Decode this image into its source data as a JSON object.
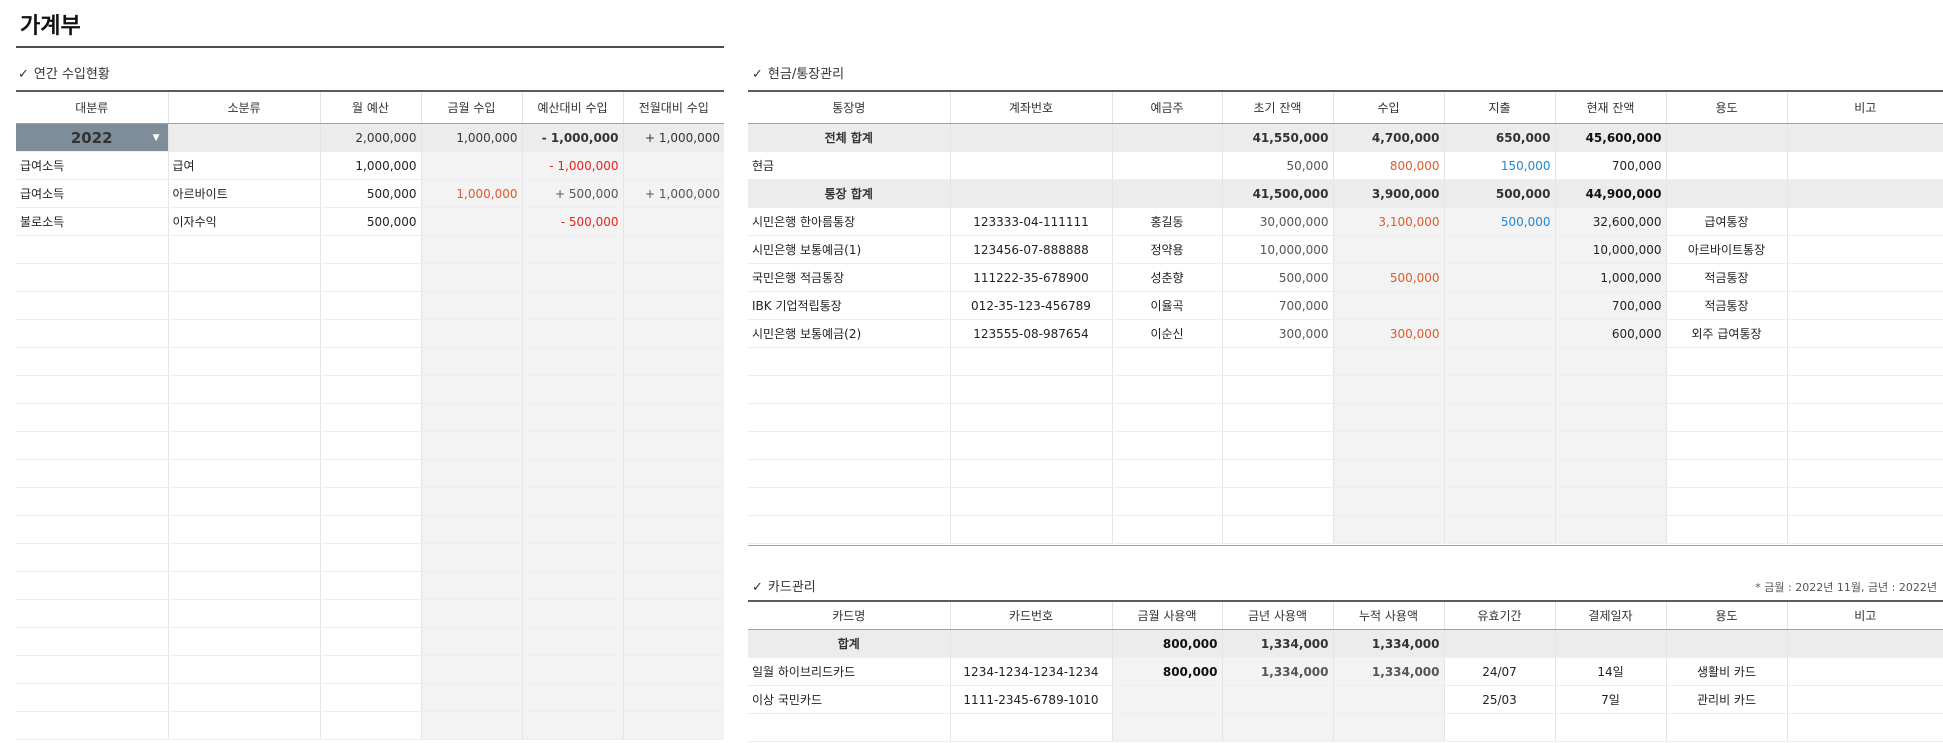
{
  "page": {
    "title": "가계부"
  },
  "income": {
    "section_title": "연간 수입현황",
    "headers": [
      "대분류",
      "소분류",
      "월 예산",
      "금월 수입",
      "예산대비 수입",
      "전월대비 수입"
    ],
    "year": "2022",
    "summary": {
      "budget": "2,000,000",
      "current": "1,000,000",
      "vs_budget": "- 1,000,000",
      "vs_prev": "+ 1,000,000"
    },
    "rows": [
      {
        "major": "급여소득",
        "minor": "급여",
        "budget": "1,000,000",
        "current": "",
        "vs_budget": "- 1,000,000",
        "vs_prev": ""
      },
      {
        "major": "급여소득",
        "minor": "아르바이트",
        "budget": "500,000",
        "current": "1,000,000",
        "vs_budget": "+ 500,000",
        "vs_prev": "+ 1,000,000"
      },
      {
        "major": "불로소득",
        "minor": "이자수익",
        "budget": "500,000",
        "current": "",
        "vs_budget": "- 500,000",
        "vs_prev": ""
      }
    ]
  },
  "accounts": {
    "section_title": "현금/통장관리",
    "headers": [
      "통장명",
      "계좌번호",
      "예금주",
      "초기 잔액",
      "수입",
      "지출",
      "현재 잔액",
      "용도",
      "비고"
    ],
    "total": {
      "label": "전체 합계",
      "initial": "41,550,000",
      "income": "4,700,000",
      "expense": "650,000",
      "current": "45,600,000"
    },
    "cash": {
      "label": "현금",
      "initial": "50,000",
      "income": "800,000",
      "expense": "150,000",
      "current": "700,000"
    },
    "bank_total": {
      "label": "통장 합계",
      "initial": "41,500,000",
      "income": "3,900,000",
      "expense": "500,000",
      "current": "44,900,000"
    },
    "rows": [
      {
        "name": "시민은행 한아름통장",
        "number": "123333-04-111111",
        "holder": "홍길동",
        "initial": "30,000,000",
        "income": "3,100,000",
        "expense": "500,000",
        "current": "32,600,000",
        "purpose": "급여통장",
        "memo": ""
      },
      {
        "name": "시민은행 보통예금(1)",
        "number": "123456-07-888888",
        "holder": "정약용",
        "initial": "10,000,000",
        "income": "",
        "expense": "",
        "current": "10,000,000",
        "purpose": "아르바이트통장",
        "memo": ""
      },
      {
        "name": "국민은행 적금통장",
        "number": "111222-35-678900",
        "holder": "성춘향",
        "initial": "500,000",
        "income": "500,000",
        "expense": "",
        "current": "1,000,000",
        "purpose": "적금통장",
        "memo": ""
      },
      {
        "name": "IBK 기업적립통장",
        "number": "012-35-123-456789",
        "holder": "이율곡",
        "initial": "700,000",
        "income": "",
        "expense": "",
        "current": "700,000",
        "purpose": "적금통장",
        "memo": ""
      },
      {
        "name": "시민은행 보통예금(2)",
        "number": "123555-08-987654",
        "holder": "이순신",
        "initial": "300,000",
        "income": "300,000",
        "expense": "",
        "current": "600,000",
        "purpose": "외주 급여통장",
        "memo": ""
      }
    ]
  },
  "cards": {
    "section_title": "카드관리",
    "note": "* 금월 : 2022년 11월, 금년 : 2022년",
    "headers": [
      "카드명",
      "카드번호",
      "금월 사용액",
      "금년 사용액",
      "누적 사용액",
      "유효기간",
      "결제일자",
      "용도",
      "비고"
    ],
    "total": {
      "label": "합계",
      "month": "800,000",
      "year": "1,334,000",
      "cumulative": "1,334,000"
    },
    "rows": [
      {
        "name": "일월 하이브리드카드",
        "number": "1234-1234-1234-1234",
        "month": "800,000",
        "year": "1,334,000",
        "cumulative": "1,334,000",
        "expiry": "24/07",
        "pay_day": "14일",
        "purpose": "생활비 카드",
        "memo": ""
      },
      {
        "name": "이상 국민카드",
        "number": "1111-2345-6789-1010",
        "month": "",
        "year": "",
        "cumulative": "",
        "expiry": "25/03",
        "pay_day": "7일",
        "purpose": "관리비 카드",
        "memo": ""
      }
    ]
  }
}
